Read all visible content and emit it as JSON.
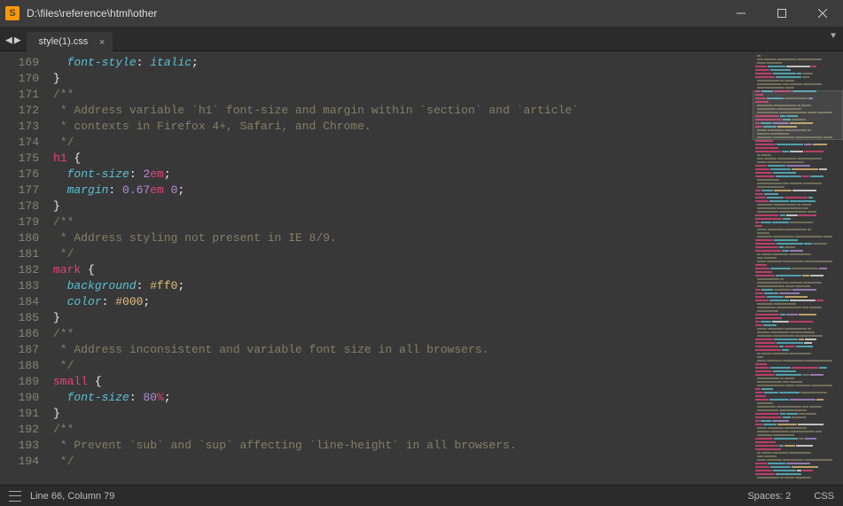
{
  "titlebar": {
    "app_icon_letter": "S",
    "title": "D:\\files\\reference\\html\\other"
  },
  "tabs": {
    "file": "style(1).css"
  },
  "editor": {
    "first_line": 169,
    "lines": [
      [
        [
          "  ",
          "punct"
        ],
        [
          "font-style",
          "prop"
        ],
        [
          ": ",
          "punct"
        ],
        [
          "italic",
          "prop"
        ],
        [
          ";",
          "punct"
        ]
      ],
      [
        [
          "}",
          "punct"
        ]
      ],
      [
        [
          "/**",
          "comment"
        ]
      ],
      [
        [
          " * Address variable `h1` font-size and margin within `section` and `article`",
          "comment"
        ]
      ],
      [
        [
          " * contexts in Firefox 4+, Safari, and Chrome.",
          "comment"
        ]
      ],
      [
        [
          " */",
          "comment"
        ]
      ],
      [
        [
          "h1",
          "selector"
        ],
        [
          " {",
          "punct"
        ]
      ],
      [
        [
          "  ",
          "punct"
        ],
        [
          "font-size",
          "prop"
        ],
        [
          ": ",
          "punct"
        ],
        [
          "2",
          "num"
        ],
        [
          "em",
          "unit"
        ],
        [
          ";",
          "punct"
        ]
      ],
      [
        [
          "  ",
          "punct"
        ],
        [
          "margin",
          "prop"
        ],
        [
          ": ",
          "punct"
        ],
        [
          "0.67",
          "num"
        ],
        [
          "em",
          "unit"
        ],
        [
          " ",
          "punct"
        ],
        [
          "0",
          "num"
        ],
        [
          ";",
          "punct"
        ]
      ],
      [
        [
          "}",
          "punct"
        ]
      ],
      [
        [
          "/**",
          "comment"
        ]
      ],
      [
        [
          " * Address styling not present in IE 8/9.",
          "comment"
        ]
      ],
      [
        [
          " */",
          "comment"
        ]
      ],
      [
        [
          "mark",
          "selector"
        ],
        [
          " {",
          "punct"
        ]
      ],
      [
        [
          "  ",
          "punct"
        ],
        [
          "background",
          "prop"
        ],
        [
          ": ",
          "punct"
        ],
        [
          "#ff0",
          "hex"
        ],
        [
          ";",
          "punct"
        ]
      ],
      [
        [
          "  ",
          "punct"
        ],
        [
          "color",
          "prop"
        ],
        [
          ": ",
          "punct"
        ],
        [
          "#000",
          "hex"
        ],
        [
          ";",
          "punct"
        ]
      ],
      [
        [
          "}",
          "punct"
        ]
      ],
      [
        [
          "/**",
          "comment"
        ]
      ],
      [
        [
          " * Address inconsistent and variable font size in all browsers.",
          "comment"
        ]
      ],
      [
        [
          " */",
          "comment"
        ]
      ],
      [
        [
          "small",
          "selector"
        ],
        [
          " {",
          "punct"
        ]
      ],
      [
        [
          "  ",
          "punct"
        ],
        [
          "font-size",
          "prop"
        ],
        [
          ": ",
          "punct"
        ],
        [
          "80",
          "num"
        ],
        [
          "%",
          "unit"
        ],
        [
          ";",
          "punct"
        ]
      ],
      [
        [
          "}",
          "punct"
        ]
      ],
      [
        [
          "/**",
          "comment"
        ]
      ],
      [
        [
          " * Prevent `sub` and `sup` affecting `line-height` in all browsers.",
          "comment"
        ]
      ],
      [
        [
          " */",
          "comment"
        ]
      ]
    ]
  },
  "minimap_colors": [
    "#e6427a",
    "#59c2d4",
    "#808066",
    "#b58cd9",
    "#e5c07b",
    "#eee"
  ],
  "statusbar": {
    "position": "Line 66, Column 79",
    "spaces": "Spaces: 2",
    "syntax": "CSS"
  }
}
